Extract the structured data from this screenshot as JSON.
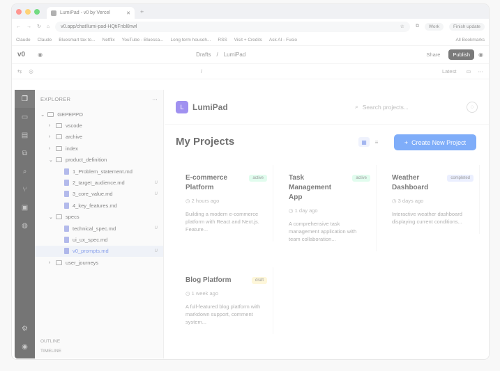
{
  "browser": {
    "tab_title": "LumiPad - v0 by Vercel",
    "url": "v0.app/chat/lumi-pad-HQtiFnbl8nwl",
    "profile": "Work",
    "finish_update": "Finish update",
    "bookmarks": [
      "Claude",
      "Claude",
      "Bluesmart tax to...",
      "Netflix",
      "YouTube - Bluesca...",
      "Long term househ...",
      "RSS",
      "Visit + Credits",
      "Ask AI - Fusio"
    ],
    "all_bookmarks": "All Bookmarks"
  },
  "v0": {
    "breadcrumb_folder": "Drafts",
    "breadcrumb_project": "LumiPad",
    "share": "Share",
    "publish": "Publish",
    "version": "Latest",
    "path": "/"
  },
  "sidebar": {
    "title": "EXPLORER",
    "root": "GEPEPPO",
    "items": [
      {
        "label": "vscode",
        "type": "folder",
        "indent": 1,
        "badge": ""
      },
      {
        "label": "archive",
        "type": "folder",
        "indent": 1,
        "badge": ""
      },
      {
        "label": "index",
        "type": "folder",
        "indent": 1,
        "badge": ""
      },
      {
        "label": "product_definition",
        "type": "folder",
        "indent": 1,
        "badge": ""
      },
      {
        "label": "1_Problem_statement.md",
        "type": "file",
        "indent": 2,
        "badge": ""
      },
      {
        "label": "2_target_audience.md",
        "type": "file",
        "indent": 2,
        "badge": "U"
      },
      {
        "label": "3_core_value.md",
        "type": "file",
        "indent": 2,
        "badge": "U"
      },
      {
        "label": "4_key_features.md",
        "type": "file",
        "indent": 2,
        "badge": ""
      },
      {
        "label": "specs",
        "type": "folder",
        "indent": 1,
        "badge": ""
      },
      {
        "label": "technical_spec.md",
        "type": "file",
        "indent": 2,
        "badge": "U"
      },
      {
        "label": "ui_ux_spec.md",
        "type": "file",
        "indent": 2,
        "badge": ""
      },
      {
        "label": "v0_prompts.md",
        "type": "file",
        "indent": 2,
        "badge": "U",
        "selected": true
      },
      {
        "label": "user_journeys",
        "type": "folder",
        "indent": 1,
        "badge": ""
      }
    ],
    "outline": "OUTLINE",
    "timeline": "TIMELINE"
  },
  "app": {
    "name": "LumiPad",
    "search_placeholder": "Search projects...",
    "heading": "My Projects",
    "create_button": "Create New Project",
    "projects": [
      {
        "name": "E-commerce Platform",
        "status": "active",
        "time": "2 hours ago",
        "desc": "Building a modern e-commerce platform with React and Next.js. Feature..."
      },
      {
        "name": "Task Management App",
        "status": "active",
        "time": "1 day ago",
        "desc": "A comprehensive task management application with team collaboration..."
      },
      {
        "name": "Weather Dashboard",
        "status": "completed",
        "time": "3 days ago",
        "desc": "Interactive weather dashboard displaying current conditions..."
      },
      {
        "name": "Blog Platform",
        "status": "draft",
        "time": "1 week ago",
        "desc": "A full-featured blog platform with markdown support, comment system..."
      }
    ]
  },
  "colors": {
    "accent": "#3b82f6",
    "active_badge": "#d1fae5",
    "completed_badge": "#e0e7ff",
    "draft_badge": "#fef3c7"
  }
}
